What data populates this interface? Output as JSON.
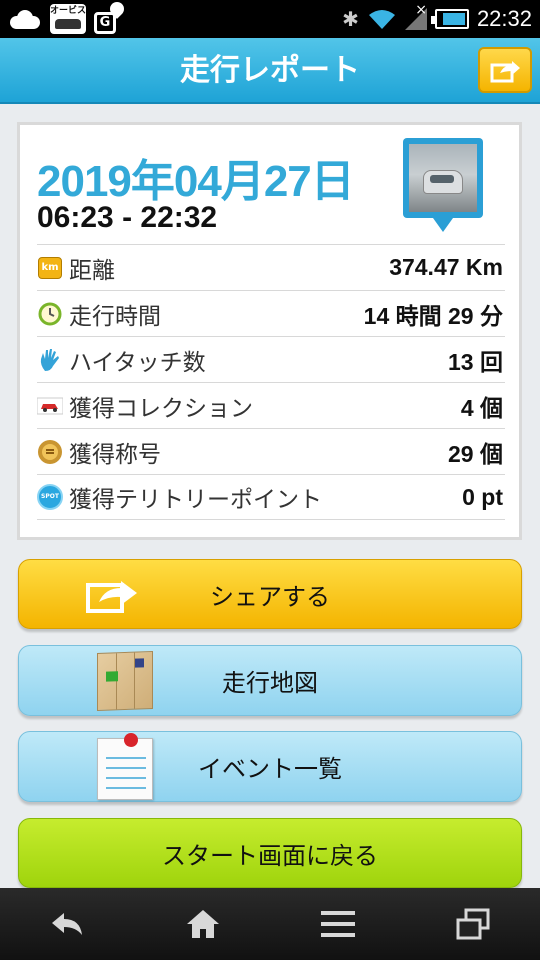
{
  "status_bar": {
    "time": "22:32",
    "orbis_label": "オービス",
    "g_label": "G"
  },
  "header": {
    "title": "走行レポート"
  },
  "report": {
    "date": "2019年04月27日",
    "time_range": "06:23 - 22:32",
    "rows": [
      {
        "icon": "km-icon",
        "label": "距離",
        "value": "374.47 Km"
      },
      {
        "icon": "clock-icon",
        "label": "走行時間",
        "value": "14 時間 29 分"
      },
      {
        "icon": "hand-icon",
        "label": "ハイタッチ数",
        "value": "13 回"
      },
      {
        "icon": "car-icon",
        "label": "獲得コレクション",
        "value": "4 個"
      },
      {
        "icon": "medal-icon",
        "label": "獲得称号",
        "value": "29 個"
      },
      {
        "icon": "spot-icon",
        "label": "獲得テリトリーポイント",
        "value": "0 pt"
      }
    ],
    "km_icon_text": "km",
    "spot_icon_text": "SPOT"
  },
  "buttons": {
    "share": "シェアする",
    "map": "走行地図",
    "events": "イベント一覧",
    "back_to_start": "スタート画面に戻る"
  },
  "colors": {
    "header": "#1ea3d6",
    "date": "#33a9d8",
    "share_button": "#f4b400",
    "blue_button": "#8fd3ef",
    "green_button": "#9fd40c"
  }
}
